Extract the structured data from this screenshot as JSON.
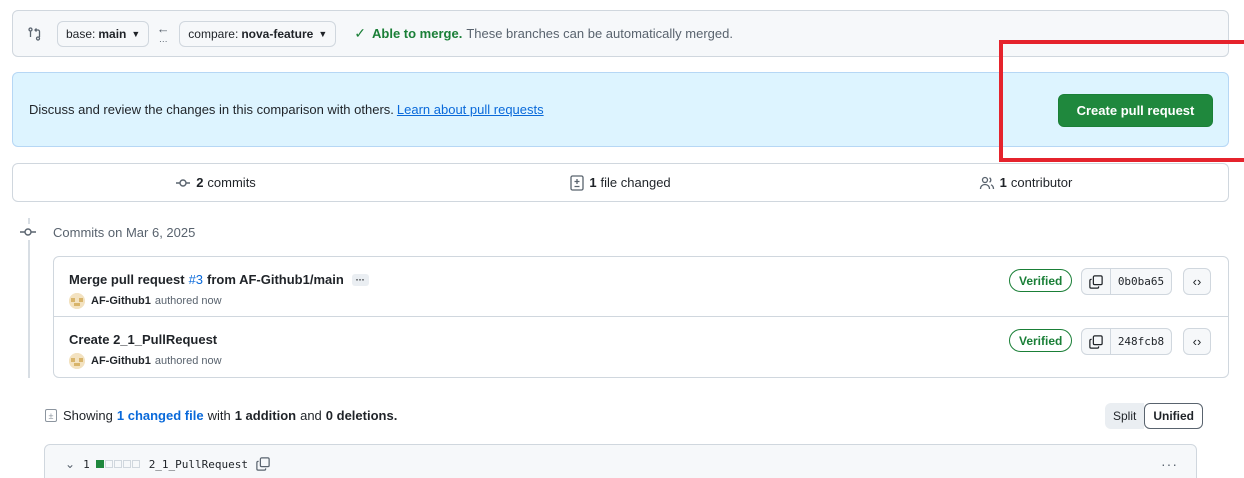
{
  "range": {
    "base_label": "base:",
    "base_value": "main",
    "compare_label": "compare:",
    "compare_value": "nova-feature",
    "merge_status_strong": "Able to merge.",
    "merge_status_text": "These branches can be automatically merged."
  },
  "discuss": {
    "text": "Discuss and review the changes in this comparison with others.",
    "link": "Learn about pull requests",
    "create_button": "Create pull request"
  },
  "summary": {
    "commits_count": "2",
    "commits_label": "commits",
    "files_count": "1",
    "files_label": "file changed",
    "contributors_count": "1",
    "contributors_label": "contributor"
  },
  "commits_date": "Commits on Mar 6, 2025",
  "commits": [
    {
      "title_prefix": "Merge pull request",
      "pr_ref": "#3",
      "title_suffix": "from AF-Github1/main",
      "author": "AF-Github1",
      "time": "authored now",
      "badge": "Verified",
      "sha": "0b0ba65"
    },
    {
      "title_prefix": "Create 2_1_PullRequest",
      "author": "AF-Github1",
      "time": "authored now",
      "badge": "Verified",
      "sha": "248fcb8"
    }
  ],
  "showing": {
    "prefix": "Showing",
    "link": "1 changed file",
    "with": "with",
    "additions": "1 addition",
    "and": "and",
    "deletions": "0 deletions."
  },
  "view_toggle": {
    "split": "Split",
    "unified": "Unified"
  },
  "file": {
    "count": "1",
    "name": "2_1_PullRequest",
    "diffstat_added": 1,
    "diffstat_total": 5
  },
  "colors": {
    "accent_green": "#1f883d",
    "link_blue": "#0969da",
    "highlight_red": "#e5232c"
  }
}
